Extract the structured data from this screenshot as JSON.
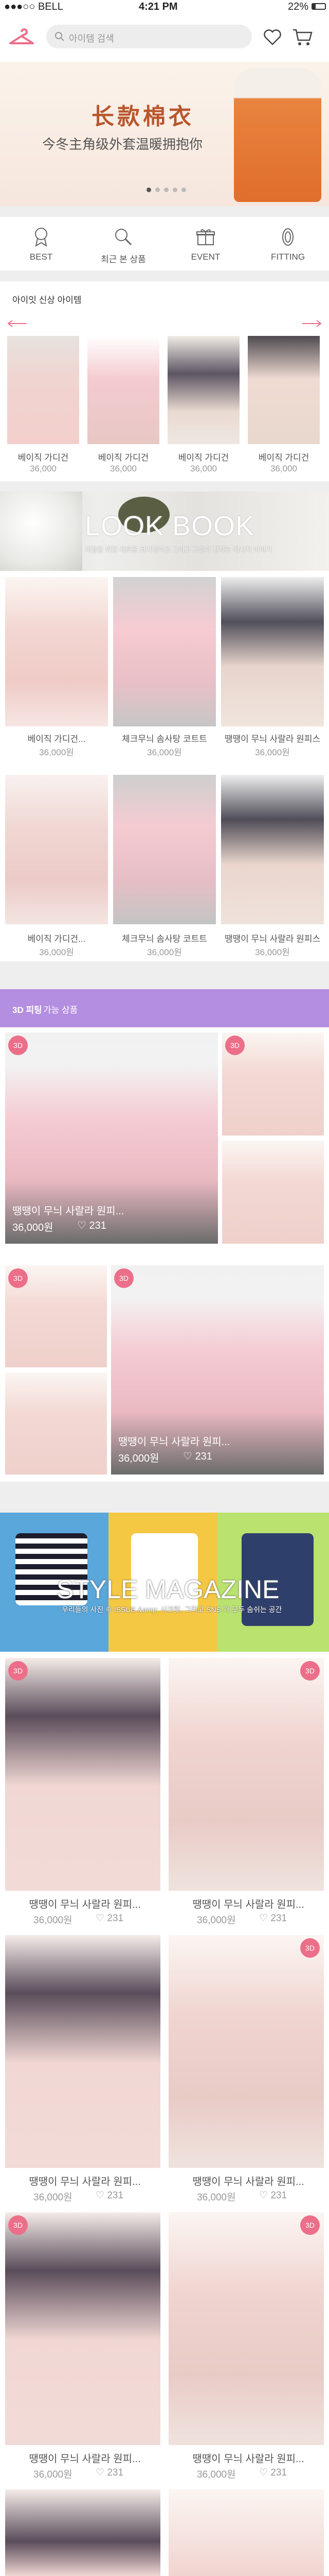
{
  "status": {
    "carrier": "●●●○○ BELL",
    "time": "4:21 PM",
    "battery": "22%"
  },
  "header": {
    "search_placeholder": "아이템 검색"
  },
  "hero": {
    "title": "长款棉衣",
    "subtitle": "今冬主角级外套温暖拥抱你",
    "dots": 5
  },
  "categories": [
    {
      "label": "BEST",
      "icon": "ribbon-icon"
    },
    {
      "label": "최근 본 상품",
      "icon": "search-icon"
    },
    {
      "label": "EVENT",
      "icon": "gift-icon"
    },
    {
      "label": "FITTING",
      "icon": "hanger-icon"
    }
  ],
  "new_items": {
    "title": "아이잇 신상 아이템",
    "items": [
      {
        "name": "베이직 가디건",
        "price": "36,000"
      },
      {
        "name": "베이직 가디건",
        "price": "36,000"
      },
      {
        "name": "베이직 가디건",
        "price": "36,000"
      },
      {
        "name": "베이직 가디건",
        "price": "36,000"
      }
    ]
  },
  "lookbook": {
    "title": "LOOK BOOK",
    "subtitle": "계절을 위한 새로운 코디네이션 그리고 그들이 전하는 메시지 이야기",
    "items": [
      {
        "name": "베이직 가디건...",
        "price": "36,000원"
      },
      {
        "name": "체크무늬 솜사탕 코트트",
        "price": "36,000원"
      },
      {
        "name": "땡땡이 무늬 사랄라 원피스",
        "price": "36,000원"
      },
      {
        "name": "베이직 가디건...",
        "price": "36,000원"
      },
      {
        "name": "체크무늬 솜사탕 코트트",
        "price": "36,000원"
      },
      {
        "name": "땡땡이 무늬 사랄라 원피스",
        "price": "36,000원"
      }
    ]
  },
  "fitting3d": {
    "title_prefix": "3D 피팅",
    "title_suffix": " 가능 상품",
    "badge": "3D",
    "cards": [
      {
        "name": "땡땡이 무늬 사랄라 원피...",
        "price": "36,000원",
        "likes": "231"
      },
      {
        "name": "땡땡이 무늬 사랄라 원피...",
        "price": "36,000원",
        "likes": "231"
      }
    ]
  },
  "magazine": {
    "title": "STYLE MAGAZINE",
    "subtitle": "우리들의 사진 속 ISSUE &amp; 시크릿, 그리고 SNS 가 모두 숨쉬는 공간",
    "items": [
      {
        "name": "땡땡이 무늬 사랄라 원피...",
        "price": "36,000원",
        "likes": "231"
      },
      {
        "name": "땡땡이 무늬 사랄라 원피...",
        "price": "36,000원",
        "likes": "231"
      },
      {
        "name": "땡땡이 무늬 사랄라 원피...",
        "price": "36,000원",
        "likes": "231"
      },
      {
        "name": "땡땡이 무늬 사랄라 원피...",
        "price": "36,000원",
        "likes": "231"
      },
      {
        "name": "땡땡이 무늬 사랄라 원피...",
        "price": "36,000원",
        "likes": "231"
      },
      {
        "name": "땡땡이 무늬 사랄라 원피...",
        "price": "36,000원",
        "likes": "231"
      }
    ]
  },
  "colors": {
    "accent": "#ec6f8a",
    "purple": "#b48ee0"
  }
}
